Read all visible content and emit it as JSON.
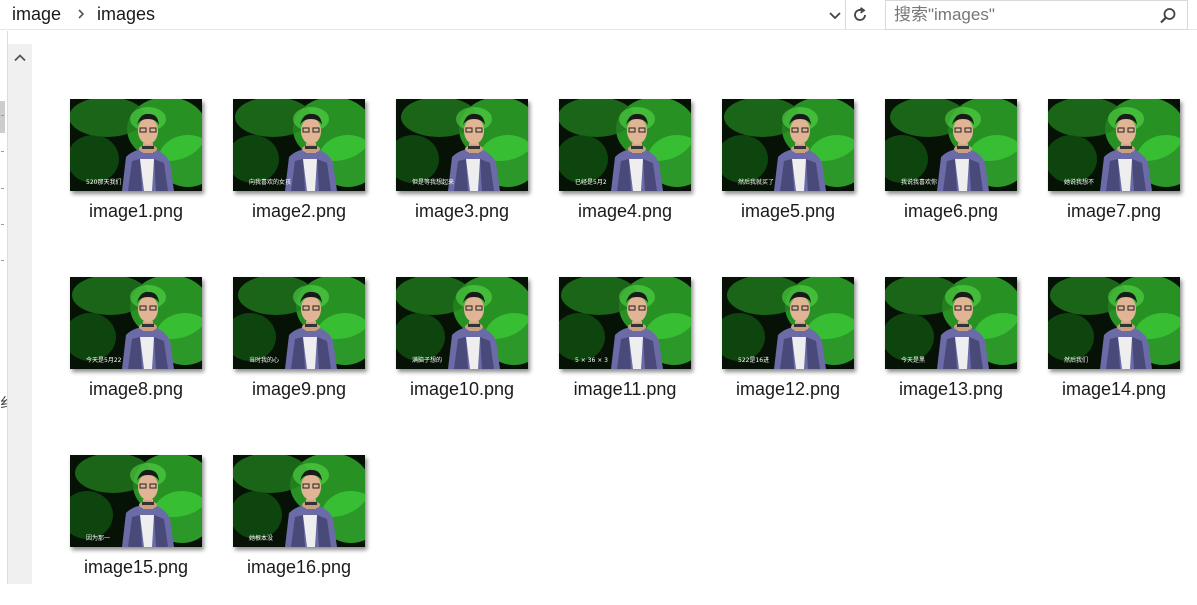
{
  "breadcrumb": [
    "image",
    "images"
  ],
  "search": {
    "placeholder": "搜索\"images\""
  },
  "files": [
    {
      "name": "image1.png",
      "caption": "520那天我们"
    },
    {
      "name": "image2.png",
      "caption": "向我喜欢的女孩"
    },
    {
      "name": "image3.png",
      "caption": "但是等我想起来"
    },
    {
      "name": "image4.png",
      "caption": "已经是5月2"
    },
    {
      "name": "image5.png",
      "caption": "然后我就买了"
    },
    {
      "name": "image6.png",
      "caption": "我说我喜欢你"
    },
    {
      "name": "image7.png",
      "caption": "她说我想不"
    },
    {
      "name": "image8.png",
      "caption": "今天是5月22"
    },
    {
      "name": "image9.png",
      "caption": "当时我的心"
    },
    {
      "name": "image10.png",
      "caption": "满脑子想的"
    },
    {
      "name": "image11.png",
      "caption": "5 × 36 × 3"
    },
    {
      "name": "image12.png",
      "caption": "522是16进"
    },
    {
      "name": "image13.png",
      "caption": "今天是黑"
    },
    {
      "name": "image14.png",
      "caption": "然后我们"
    },
    {
      "name": "image15.png",
      "caption": "因为那一"
    },
    {
      "name": "image16.png",
      "caption": "她根本没"
    }
  ],
  "left_pane": {
    "text": "纟"
  },
  "colors": {
    "accent": "#1a1a1a",
    "thumb_bg": "#0a1a0a",
    "smoke": "#3fd23a"
  },
  "icons": {
    "dropdown": "chevron-down-icon",
    "refresh": "refresh-icon",
    "search": "search-icon",
    "scroll_up": "chevron-up-icon"
  }
}
